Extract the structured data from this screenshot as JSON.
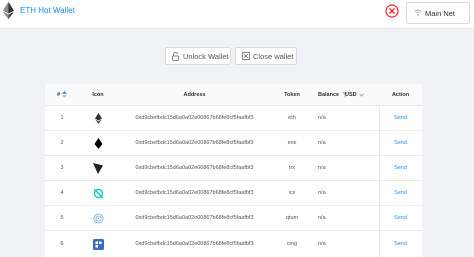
{
  "app": {
    "title": "ETH Hot Wallet"
  },
  "network": {
    "selected": "Main Net"
  },
  "buttons": {
    "unlock": "Unlock Wallet",
    "close": "Close wallet"
  },
  "table": {
    "headers": {
      "num": "#",
      "icon": "Icon",
      "address": "Address",
      "token": "Token",
      "balance": "Balance",
      "usd": "USD",
      "action": "Action"
    },
    "rows": [
      {
        "num": "1",
        "icon": "eth-token-icon",
        "address": "0xd9cbefbdc15d6a0a02e00867b68fe8cf5faafbf3",
        "token": "eth",
        "balance": "n/a",
        "action": "Send"
      },
      {
        "num": "2",
        "icon": "eos-token-icon",
        "address": "0xd9cbefbdc15d6a0a02e00867b68fe8cf5faafbf3",
        "token": "eos",
        "balance": "n/a",
        "action": "Send"
      },
      {
        "num": "3",
        "icon": "trx-token-icon",
        "address": "0xd9cbefbdc15d6a0a02e00867b68fe8cf5faafbf3",
        "token": "trx",
        "balance": "n/a",
        "action": "Send"
      },
      {
        "num": "4",
        "icon": "icx-token-icon",
        "address": "0xd9cbefbdc15d6a0a02e00867b68fe8cf5faafbf3",
        "token": "icx",
        "balance": "n/a",
        "action": "Send"
      },
      {
        "num": "5",
        "icon": "qtum-token-icon",
        "address": "0xd9cbefbdc15d6a0a02e00867b68fe8cf5faafbf3",
        "token": "qtum",
        "balance": "n/a",
        "action": "Send"
      },
      {
        "num": "6",
        "icon": "cmg-token-icon",
        "address": "0xd9cbefbdc15d6a0a02e00867b68fe8cf5faafbf3",
        "token": "cmg",
        "balance": "n/a",
        "action": "Send"
      }
    ]
  },
  "colors": {
    "accent": "#1890ff",
    "danger": "#f5222d",
    "background": "#f0f2f5"
  }
}
